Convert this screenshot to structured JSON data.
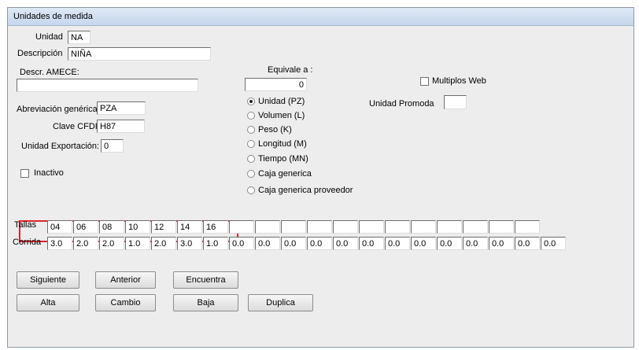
{
  "window": {
    "title": "Unidades de medida"
  },
  "form": {
    "unidad_label": "Unidad",
    "unidad_value": "NA",
    "descripcion_label": "Descripción",
    "descripcion_value": "NIÑA",
    "amece_label": "Descr. AMECE:",
    "amece_value": "",
    "equivale_label": "Equivale a :",
    "equivale_value": "0",
    "multiplos_label": "Multiplos Web",
    "multiplos_checked": false,
    "abreviacion_label": "Abreviación genérica:",
    "abreviacion_value": "PZA",
    "cfdi_label": "Clave CFDI:",
    "cfdi_value": "H87",
    "exportacion_label": "Unidad Exportación:",
    "exportacion_value": "0",
    "promoda_label": "Unidad Promoda",
    "promoda_value": "",
    "inactivo_label": "Inactivo",
    "inactivo_checked": false
  },
  "equivalence_options": [
    {
      "label": "Unidad (PZ)",
      "selected": true
    },
    {
      "label": "Volumen (L)",
      "selected": false
    },
    {
      "label": "Peso (K)",
      "selected": false
    },
    {
      "label": "Longitud (M)",
      "selected": false
    },
    {
      "label": "Tiempo (MN)",
      "selected": false
    },
    {
      "label": "Caja generica",
      "selected": false
    },
    {
      "label": "Caja generica proveedor",
      "selected": false
    }
  ],
  "sizes": {
    "tallas_label": "Tallas",
    "corrida_label": "Corrida",
    "tallas": [
      "04",
      "06",
      "08",
      "10",
      "12",
      "14",
      "16",
      "",
      "",
      "",
      "",
      "",
      "",
      "",
      "",
      "",
      "",
      "",
      ""
    ],
    "corrida": [
      "3.0",
      "2.0",
      "2.0",
      "1.0",
      "2.0",
      "3.0",
      "1.0",
      "0.0",
      "0.0",
      "0.0",
      "0.0",
      "0.0",
      "0.0",
      "0.0",
      "0.0",
      "0.0",
      "0.0",
      "0.0",
      "0.0",
      "0.0"
    ]
  },
  "buttons": {
    "siguiente": "Siguiente",
    "anterior": "Anterior",
    "encuentra": "Encuentra",
    "alta": "Alta",
    "cambio": "Cambio",
    "baja": "Baja",
    "duplica": "Duplica"
  },
  "colors": {
    "highlight": "#e0242b",
    "window_bg": "#ededed",
    "titlebar": "#c6d6ec"
  }
}
